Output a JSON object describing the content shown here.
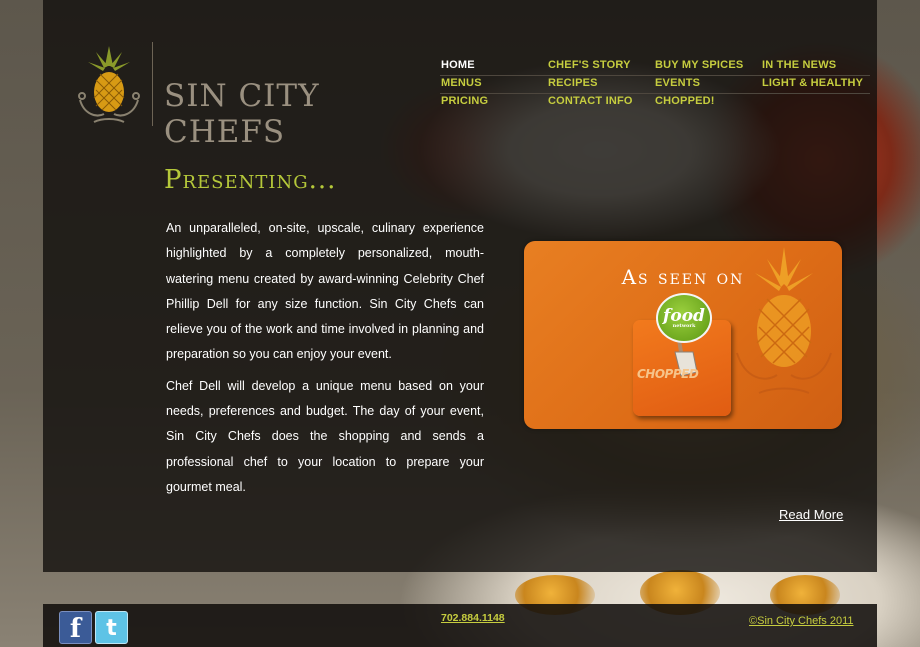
{
  "brand": {
    "name": "SIN CITY CHEFS",
    "logo_icon": "pineapple-icon"
  },
  "nav": {
    "rows": [
      [
        {
          "label": "HOME",
          "active": true
        },
        {
          "label": "CHEF'S STORY"
        },
        {
          "label": "BUY MY SPICES"
        },
        {
          "label": "IN THE NEWS"
        }
      ],
      [
        {
          "label": "MENUS"
        },
        {
          "label": "RECIPES"
        },
        {
          "label": "EVENTS"
        },
        {
          "label": "LIGHT & HEALTHY"
        }
      ],
      [
        {
          "label": "PRICING"
        },
        {
          "label": "CONTACT INFO"
        },
        {
          "label": "CHOPPED!"
        }
      ]
    ]
  },
  "main": {
    "heading": "Presenting...",
    "paragraphs": [
      "An unparalleled, on-site, upscale, culinary experience highlighted by a completely personalized, mouth-watering menu created by award-winning Celebrity Chef Phillip Dell for any size function. Sin City Chefs can relieve you of the work and time involved in planning and preparation so you can enjoy your event.",
      "Chef Dell will develop a unique menu based on your needs, preferences and budget.  The day of your event, Sin City Chefs does the shopping and sends a professional chef to your location to prepare your gourmet meal."
    ],
    "read_more": "Read More"
  },
  "promo": {
    "title": "As seen on",
    "food_logo": "food",
    "food_sub": "network",
    "chopped": "CHOPPED"
  },
  "footer": {
    "phone": "702.884.1148",
    "copyright": "©Sin City Chefs 2011",
    "social": [
      "facebook-icon",
      "twitter-icon"
    ]
  },
  "colors": {
    "accent": "#c6cd3f",
    "heading": "#b5c83a",
    "promo": "#e27320"
  }
}
